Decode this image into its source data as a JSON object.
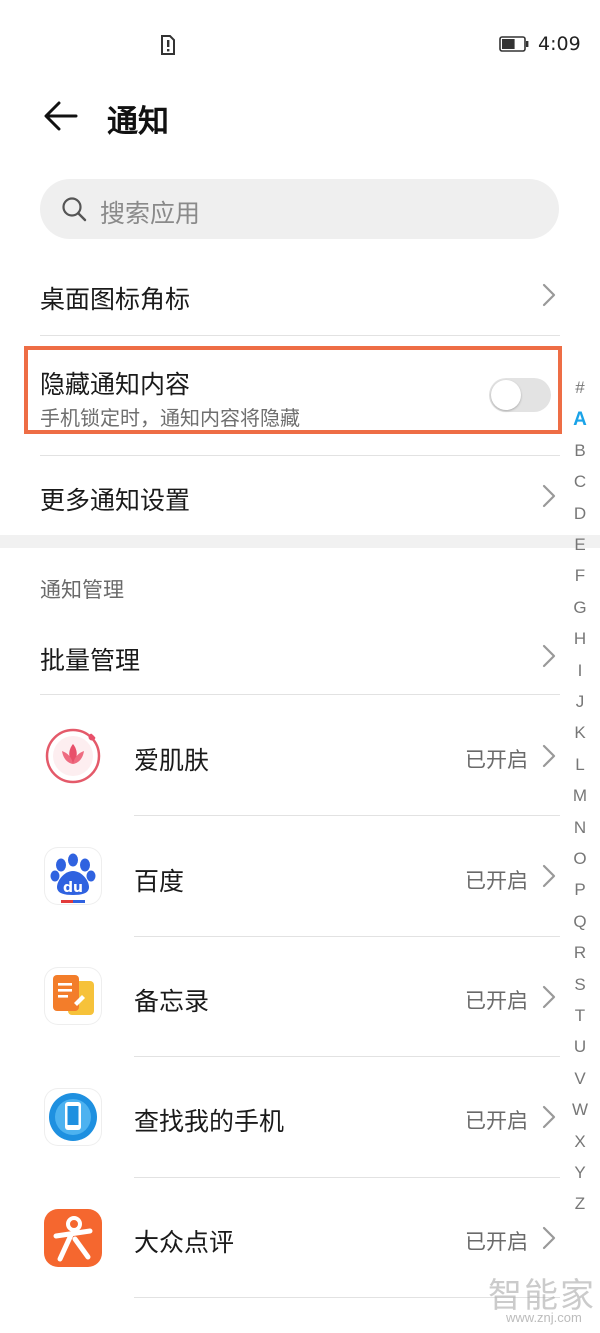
{
  "status_bar": {
    "time": "4:09",
    "battery_level": 0.6,
    "icons": [
      "sim-alert-icon",
      "battery-icon"
    ]
  },
  "header": {
    "title": "通知",
    "back_icon": "arrow-left-icon"
  },
  "search": {
    "placeholder": "搜索应用",
    "icon": "search-icon"
  },
  "settings": {
    "badge": {
      "label": "桌面图标角标"
    },
    "hide_content": {
      "label": "隐藏通知内容",
      "subtitle": "手机锁定时，通知内容将隐藏",
      "enabled": false
    },
    "more": {
      "label": "更多通知设置"
    }
  },
  "notification_management": {
    "section_label": "通知管理",
    "batch": {
      "label": "批量管理"
    },
    "apps": [
      {
        "name": "爱肌肤",
        "status": "已开启",
        "icon": "lotus-app-icon"
      },
      {
        "name": "百度",
        "status": "已开启",
        "icon": "baidu-paw-icon"
      },
      {
        "name": "备忘录",
        "status": "已开启",
        "icon": "notes-icon"
      },
      {
        "name": "查找我的手机",
        "status": "已开启",
        "icon": "find-phone-icon"
      },
      {
        "name": "大众点评",
        "status": "已开启",
        "icon": "dianping-icon"
      }
    ]
  },
  "alphabet_index": {
    "letters": [
      "#",
      "A",
      "B",
      "C",
      "D",
      "E",
      "F",
      "G",
      "H",
      "I",
      "J",
      "K",
      "L",
      "M",
      "N",
      "O",
      "P",
      "Q",
      "R",
      "S",
      "T",
      "U",
      "V",
      "W",
      "X",
      "Y",
      "Z"
    ],
    "active": "A"
  },
  "colors": {
    "accent": "#1aa3e8",
    "highlight": "#ee6d45",
    "toggle_off": "#e3e3e3"
  },
  "watermark": {
    "text": "智能家",
    "url": "www.znj.com"
  }
}
